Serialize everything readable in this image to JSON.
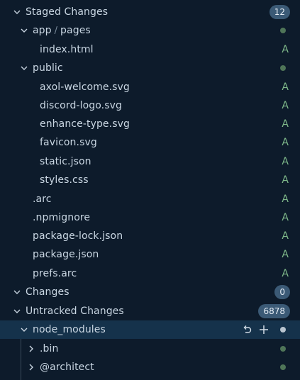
{
  "sections": {
    "staged": {
      "label": "Staged Changes",
      "count": "12"
    },
    "changes": {
      "label": "Changes",
      "count": "0"
    },
    "untracked": {
      "label": "Untracked Changes",
      "count": "6878"
    }
  },
  "staged_items": {
    "app_pages": {
      "folder": "app",
      "separator": "/",
      "subfolder": "pages"
    },
    "index_html": {
      "name": "index.html",
      "status": "A"
    },
    "public": {
      "name": "public"
    },
    "axol_welcome": {
      "name": "axol-welcome.svg",
      "status": "A"
    },
    "discord_logo": {
      "name": "discord-logo.svg",
      "status": "A"
    },
    "enhance_type": {
      "name": "enhance-type.svg",
      "status": "A"
    },
    "favicon": {
      "name": "favicon.svg",
      "status": "A"
    },
    "static_json": {
      "name": "static.json",
      "status": "A"
    },
    "styles_css": {
      "name": "styles.css",
      "status": "A"
    },
    "arc": {
      "name": ".arc",
      "status": "A"
    },
    "npmignore": {
      "name": ".npmignore",
      "status": "A"
    },
    "package_lock": {
      "name": "package-lock.json",
      "status": "A"
    },
    "package_json": {
      "name": "package.json",
      "status": "A"
    },
    "prefs_arc": {
      "name": "prefs.arc",
      "status": "A"
    }
  },
  "untracked_items": {
    "node_modules": {
      "name": "node_modules"
    },
    "bin": {
      "name": ".bin"
    },
    "architect": {
      "name": "@architect"
    }
  },
  "icons": {
    "chevron_down": "chevron-down-icon",
    "chevron_right": "chevron-right-icon",
    "discard": "discard-icon",
    "stage": "plus-icon"
  },
  "colors": {
    "background": "#0d1b2b",
    "selected_row": "#15324b",
    "badge": "#3b5a76",
    "added_status": "#7fb98a",
    "modified_dot": "#4f7558"
  }
}
